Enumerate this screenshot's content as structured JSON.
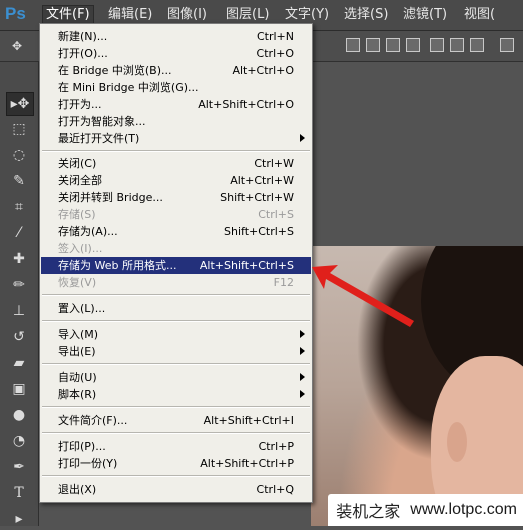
{
  "app": {
    "logo": "Ps"
  },
  "menubar": [
    {
      "label": "文件(F)",
      "active": true
    },
    {
      "label": "编辑(E)"
    },
    {
      "label": "图像(I)"
    },
    {
      "label": "图层(L)"
    },
    {
      "label": "文字(Y)"
    },
    {
      "label": "选择(S)"
    },
    {
      "label": "滤镜(T)"
    },
    {
      "label": "视图("
    }
  ],
  "file_menu": [
    {
      "label": "新建(N)...",
      "shortcut": "Ctrl+N"
    },
    {
      "label": "打开(O)...",
      "shortcut": "Ctrl+O"
    },
    {
      "label": "在 Bridge 中浏览(B)...",
      "shortcut": "Alt+Ctrl+O"
    },
    {
      "label": "在 Mini Bridge 中浏览(G)...",
      "shortcut": ""
    },
    {
      "label": "打开为...",
      "shortcut": "Alt+Shift+Ctrl+O"
    },
    {
      "label": "打开为智能对象...",
      "shortcut": ""
    },
    {
      "label": "最近打开文件(T)",
      "shortcut": "",
      "submenu": true
    },
    {
      "label": "关闭(C)",
      "shortcut": "Ctrl+W"
    },
    {
      "label": "关闭全部",
      "shortcut": "Alt+Ctrl+W"
    },
    {
      "label": "关闭并转到 Bridge...",
      "shortcut": "Shift+Ctrl+W"
    },
    {
      "label": "存储(S)",
      "shortcut": "Ctrl+S",
      "disabled": true
    },
    {
      "label": "存储为(A)...",
      "shortcut": "Shift+Ctrl+S"
    },
    {
      "label": "签入(I)...",
      "shortcut": "",
      "disabled": true
    },
    {
      "label": "存储为 Web 所用格式...",
      "shortcut": "Alt+Shift+Ctrl+S",
      "highlight": true
    },
    {
      "label": "恢复(V)",
      "shortcut": "F12",
      "disabled": true
    },
    {
      "label": "置入(L)...",
      "shortcut": ""
    },
    {
      "label": "导入(M)",
      "shortcut": "",
      "submenu": true
    },
    {
      "label": "导出(E)",
      "shortcut": "",
      "submenu": true
    },
    {
      "label": "自动(U)",
      "shortcut": "",
      "submenu": true
    },
    {
      "label": "脚本(R)",
      "shortcut": "",
      "submenu": true
    },
    {
      "label": "文件简介(F)...",
      "shortcut": "Alt+Shift+Ctrl+I"
    },
    {
      "label": "打印(P)...",
      "shortcut": "Ctrl+P"
    },
    {
      "label": "打印一份(Y)",
      "shortcut": "Alt+Shift+Ctrl+P"
    },
    {
      "label": "退出(X)",
      "shortcut": "Ctrl+Q"
    }
  ],
  "tools": [
    "move-tool",
    "marquee-tool",
    "lasso-tool",
    "quick-select-tool",
    "crop-tool",
    "eyedropper-tool",
    "healing-brush-tool",
    "brush-tool",
    "clone-stamp-tool",
    "history-brush-tool",
    "eraser-tool",
    "gradient-tool",
    "blur-tool",
    "dodge-tool",
    "pen-tool",
    "type-tool",
    "path-select-tool"
  ],
  "watermark": {
    "brand": "装机之家",
    "url": "www.lotpc.com"
  },
  "colors": {
    "highlight": "#23307b",
    "menu_bg": "#f0efe9",
    "arrow": "#e0201b"
  }
}
